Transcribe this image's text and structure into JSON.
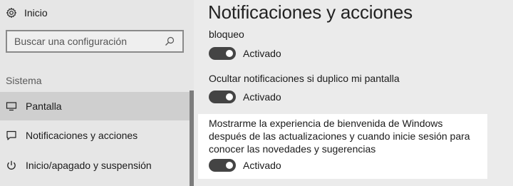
{
  "sidebar": {
    "home_label": "Inicio",
    "search_placeholder": "Buscar una configuración",
    "section_label": "Sistema",
    "items": [
      {
        "label": "Pantalla",
        "icon": "monitor-icon",
        "selected": true
      },
      {
        "label": "Notificaciones y acciones",
        "icon": "message-icon",
        "selected": false
      },
      {
        "label": "Inicio/apagado y suspensión",
        "icon": "power-icon",
        "selected": false
      }
    ]
  },
  "main": {
    "title": "Notificaciones y acciones",
    "partial_label": "bloqueo",
    "settings": [
      {
        "label": "",
        "state": "Activado",
        "on": true
      },
      {
        "label": "Ocultar notificaciones si duplico mi pantalla",
        "state": "Activado",
        "on": true
      },
      {
        "label": "Mostrarme la experiencia de bienvenida de Windows después de las actualizaciones y cuando inicie sesión para conocer las novedades y sugerencias",
        "state": "Activado",
        "on": true
      }
    ]
  },
  "colors": {
    "sidebar_bg": "#e6e6e6",
    "selected_bg": "#cfcfcf",
    "toggle_on": "#444444",
    "highlight_bg": "#ffffff"
  }
}
